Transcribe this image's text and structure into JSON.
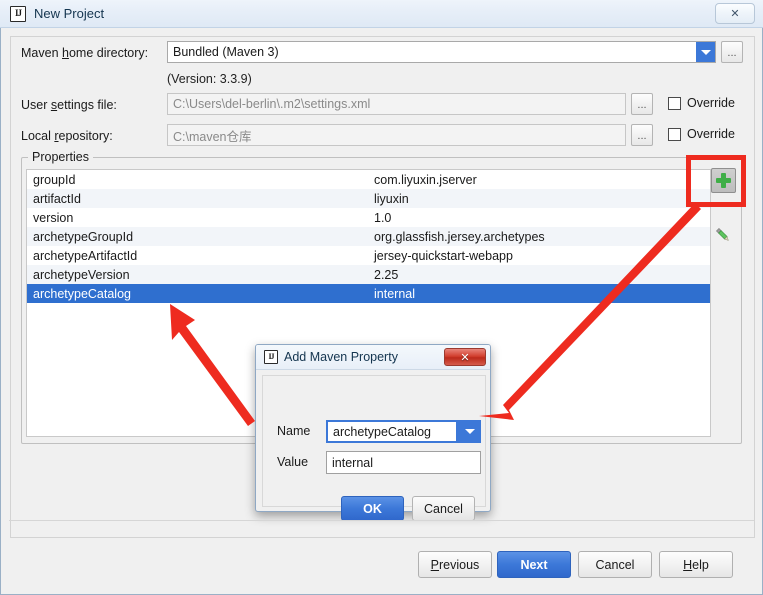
{
  "window": {
    "title": "New Project",
    "icon": "intellij-idea-icon",
    "close_label": "✕"
  },
  "fields": {
    "maven_home_label_pre": "Maven ",
    "maven_home_label_key": "h",
    "maven_home_label_post": "ome directory:",
    "maven_home_value": "Bundled (Maven 3)",
    "maven_version": "(Version: 3.3.9)",
    "user_settings_label_pre": "User ",
    "user_settings_label_key": "s",
    "user_settings_label_post": "ettings file:",
    "user_settings_value": "C:\\Users\\del-berlin\\.m2\\settings.xml",
    "local_repo_label_pre": "Local ",
    "local_repo_label_key": "r",
    "local_repo_label_post": "epository:",
    "local_repo_value": "C:\\maven仓库",
    "browse_label": "...",
    "override_label": "Override"
  },
  "properties": {
    "group_title": "Properties",
    "add_button_title": "Add",
    "edit_button_title": "Edit",
    "rows": [
      {
        "key": "groupId",
        "value": "com.liyuxin.jserver"
      },
      {
        "key": "artifactId",
        "value": "liyuxin"
      },
      {
        "key": "version",
        "value": "1.0"
      },
      {
        "key": "archetypeGroupId",
        "value": "org.glassfish.jersey.archetypes"
      },
      {
        "key": "archetypeArtifactId",
        "value": "jersey-quickstart-webapp"
      },
      {
        "key": "archetypeVersion",
        "value": "2.25"
      },
      {
        "key": "archetypeCatalog",
        "value": "internal"
      }
    ],
    "selected_row_index": 6
  },
  "modal": {
    "title": "Add Maven Property",
    "icon": "intellij-idea-icon",
    "close_label": "✕",
    "name_label": "Name",
    "name_value": "archetypeCatalog",
    "value_label": "Value",
    "value_value": "internal",
    "ok_label": "OK",
    "cancel_label": "Cancel"
  },
  "footer": {
    "previous_pre": "",
    "previous_key": "P",
    "previous_post": "revious",
    "next_label": "Next",
    "cancel_label": "Cancel",
    "help_pre": "",
    "help_key": "H",
    "help_post": "elp"
  },
  "annotations": {
    "highlight_color": "#ee2b1f",
    "arrow_color": "#ee2b1f",
    "arrow_count": 2
  },
  "colors": {
    "accent_blue": "#3c78d8",
    "selection_blue": "#2f6fcf",
    "add_green": "#3fae47",
    "annotation_red": "#ee2b1f"
  }
}
